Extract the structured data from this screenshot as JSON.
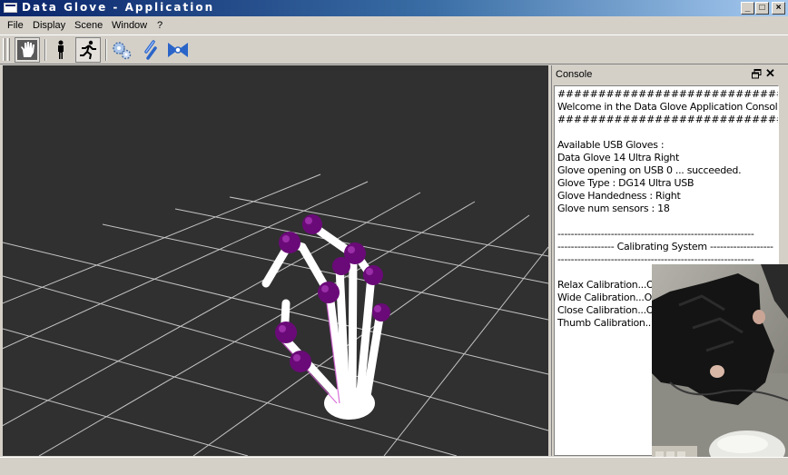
{
  "window": {
    "title": "Data Glove - Application",
    "controls": {
      "minimize": "_",
      "maximize": "□",
      "close": "×"
    }
  },
  "menu": [
    "File",
    "Display",
    "Scene",
    "Window",
    "?"
  ],
  "toolbar": {
    "buttons": [
      {
        "icon": "hand-icon",
        "active": true
      },
      {
        "icon": "person-icon",
        "active": false
      },
      {
        "icon": "running-person-icon",
        "active": true
      },
      {
        "icon": "gears-icon",
        "active": false
      },
      {
        "icon": "link-icon",
        "active": false
      },
      {
        "icon": "bowtie-icon",
        "active": false
      }
    ]
  },
  "console": {
    "title": "Console",
    "lines": [
      "############################",
      "Welcome in the Data Glove Application Console",
      "############################",
      "",
      "Available USB Gloves :",
      "Data Glove 14 Ultra Right",
      "Glove opening on USB 0 ... succeeded.",
      "Glove Type : DG14 Ultra USB",
      "Glove Handedness : Right",
      "Glove num sensors : 18",
      "",
      "-----------------------------------------------------------",
      "----------------- Calibrating System -------------------",
      "-----------------------------------------------------------",
      "",
      "Relax Calibration...OK",
      "Wide Calibration...OK",
      "Close Calibration...OK",
      "Thumb Calibration...OK"
    ]
  },
  "colors": {
    "viewport_bg": "#303030",
    "grid": "#bdbdbd",
    "bone": "#ffffff",
    "joint": "#6a0a78",
    "title_gradient_start": "#0a246a"
  }
}
